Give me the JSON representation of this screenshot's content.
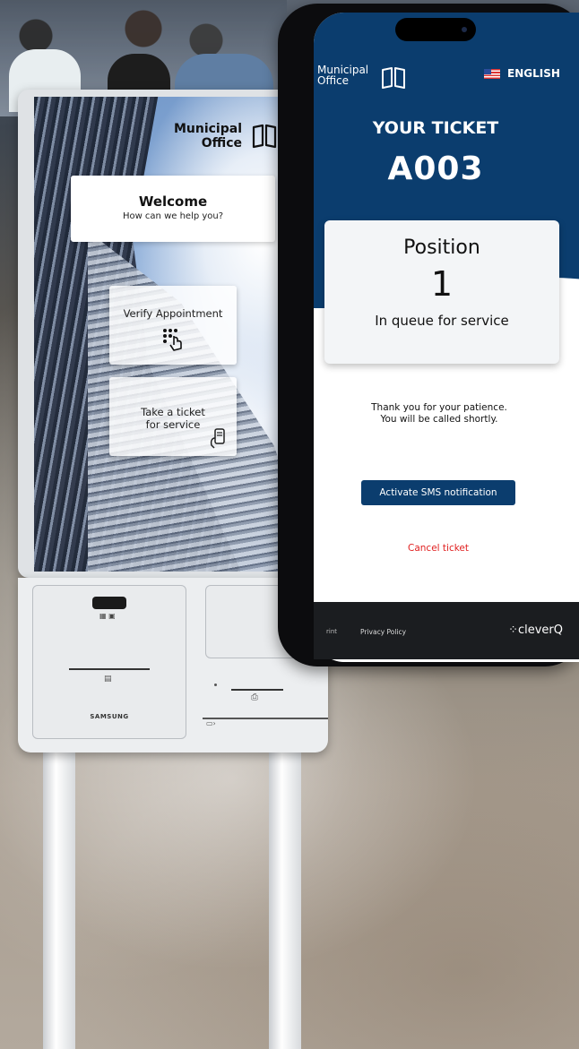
{
  "kiosk": {
    "logo_line1": "Municipal",
    "logo_line2": "Office",
    "welcome_title": "Welcome",
    "welcome_subtitle": "How can we help you?",
    "verify_button": "Verify Appointment",
    "ticket_button_line1": "Take a ticket",
    "ticket_button_line2": "for service",
    "brand": "SAMSUNG"
  },
  "phone": {
    "logo_line1": "Municipal",
    "logo_line2": "Office",
    "language": "ENGLISH",
    "ticket_title": "YOUR TICKET",
    "ticket_number": "A003",
    "position_label": "Position",
    "position_value": "1",
    "queue_text": "In queue for service",
    "thanks_line1": "Thank you for your patience.",
    "thanks_line2": "You will be called shortly.",
    "sms_button": "Activate SMS notification",
    "cancel_link": "Cancel ticket",
    "footer_link1": "rint",
    "footer_link2": "Privacy Policy",
    "footer_brand": "cleverQ"
  },
  "colors": {
    "phone_primary": "#0b3d6e",
    "cancel": "#e02020",
    "footer_bg": "#1b1d20"
  },
  "icons": [
    "book-logo-icon",
    "keypad-touch-icon",
    "phone-ticket-icon",
    "us-flag-icon",
    "qr-scanner-icon",
    "receipt-icon",
    "card-icon",
    "cleverq-icon"
  ]
}
